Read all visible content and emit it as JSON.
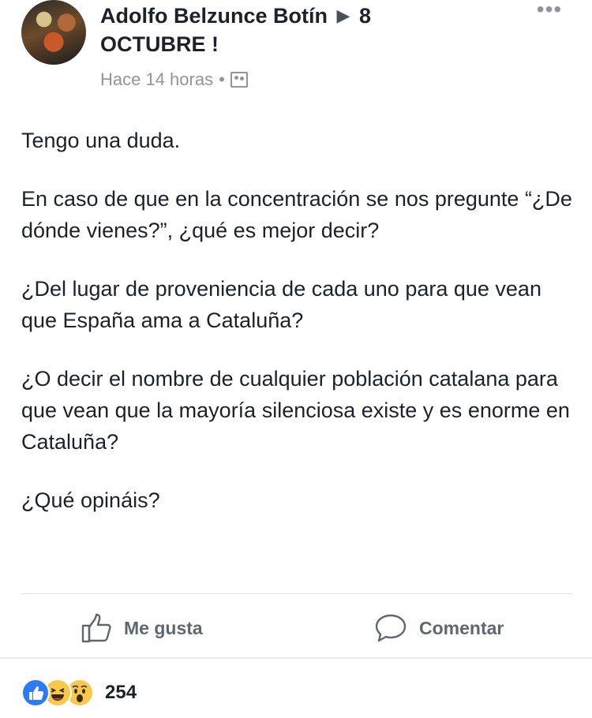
{
  "post": {
    "author": "Adolfo Belzunce Botín",
    "target_line1": "8",
    "target_line2": "OCTUBRE !",
    "timestamp": "Hace 14 horas",
    "separator": "•",
    "audience_icon": "group-audience-icon",
    "body": [
      "Tengo una duda.",
      "En caso de que en la concentración se nos pregunte “¿De dónde vienes?”, ¿qué es mejor decir?",
      "¿Del lugar de proveniencia de cada uno para que vean que España ama a Cataluña?",
      "¿O decir el nombre de cualquier población catalana para que vean que la mayoría silenciosa existe y es enorme en Cataluña?",
      "¿Qué opináis?"
    ]
  },
  "actions": {
    "like_label": "Me gusta",
    "comment_label": "Comentar"
  },
  "reactions": {
    "types": [
      "like",
      "haha",
      "wow"
    ],
    "count": "254"
  },
  "colors": {
    "text": "#1d2129",
    "meta": "#90949c",
    "action": "#606770",
    "like_blue": "#2b7bf4",
    "emoji_yellow": "#f7c84b"
  }
}
